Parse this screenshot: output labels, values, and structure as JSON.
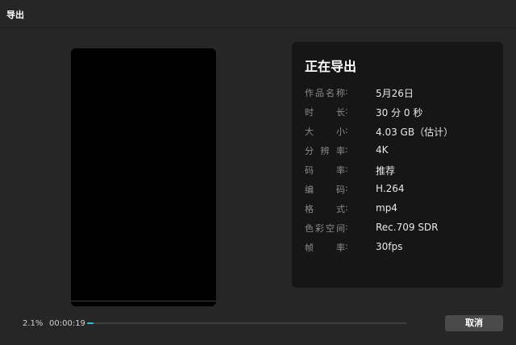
{
  "window": {
    "title": "导出"
  },
  "export": {
    "heading": "正在导出",
    "info": [
      {
        "label": "作品名称",
        "value": "5月26日"
      },
      {
        "label": "时长",
        "value": "30 分 0 秒"
      },
      {
        "label": "大小",
        "value": "4.03 GB（估计）"
      },
      {
        "label": "分辨率",
        "value": "4K"
      },
      {
        "label": "码率",
        "value": "推荐"
      },
      {
        "label": "编码",
        "value": "H.264"
      },
      {
        "label": "格式",
        "value": "mp4"
      },
      {
        "label": "色彩空间",
        "value": "Rec.709 SDR"
      },
      {
        "label": "帧率",
        "value": "30fps"
      }
    ],
    "colon": ":"
  },
  "progress": {
    "percent_label": "2.1%",
    "percent": 2.1,
    "elapsed": "00:00:19",
    "accent_color": "#26c6da"
  },
  "actions": {
    "cancel_label": "取消"
  }
}
